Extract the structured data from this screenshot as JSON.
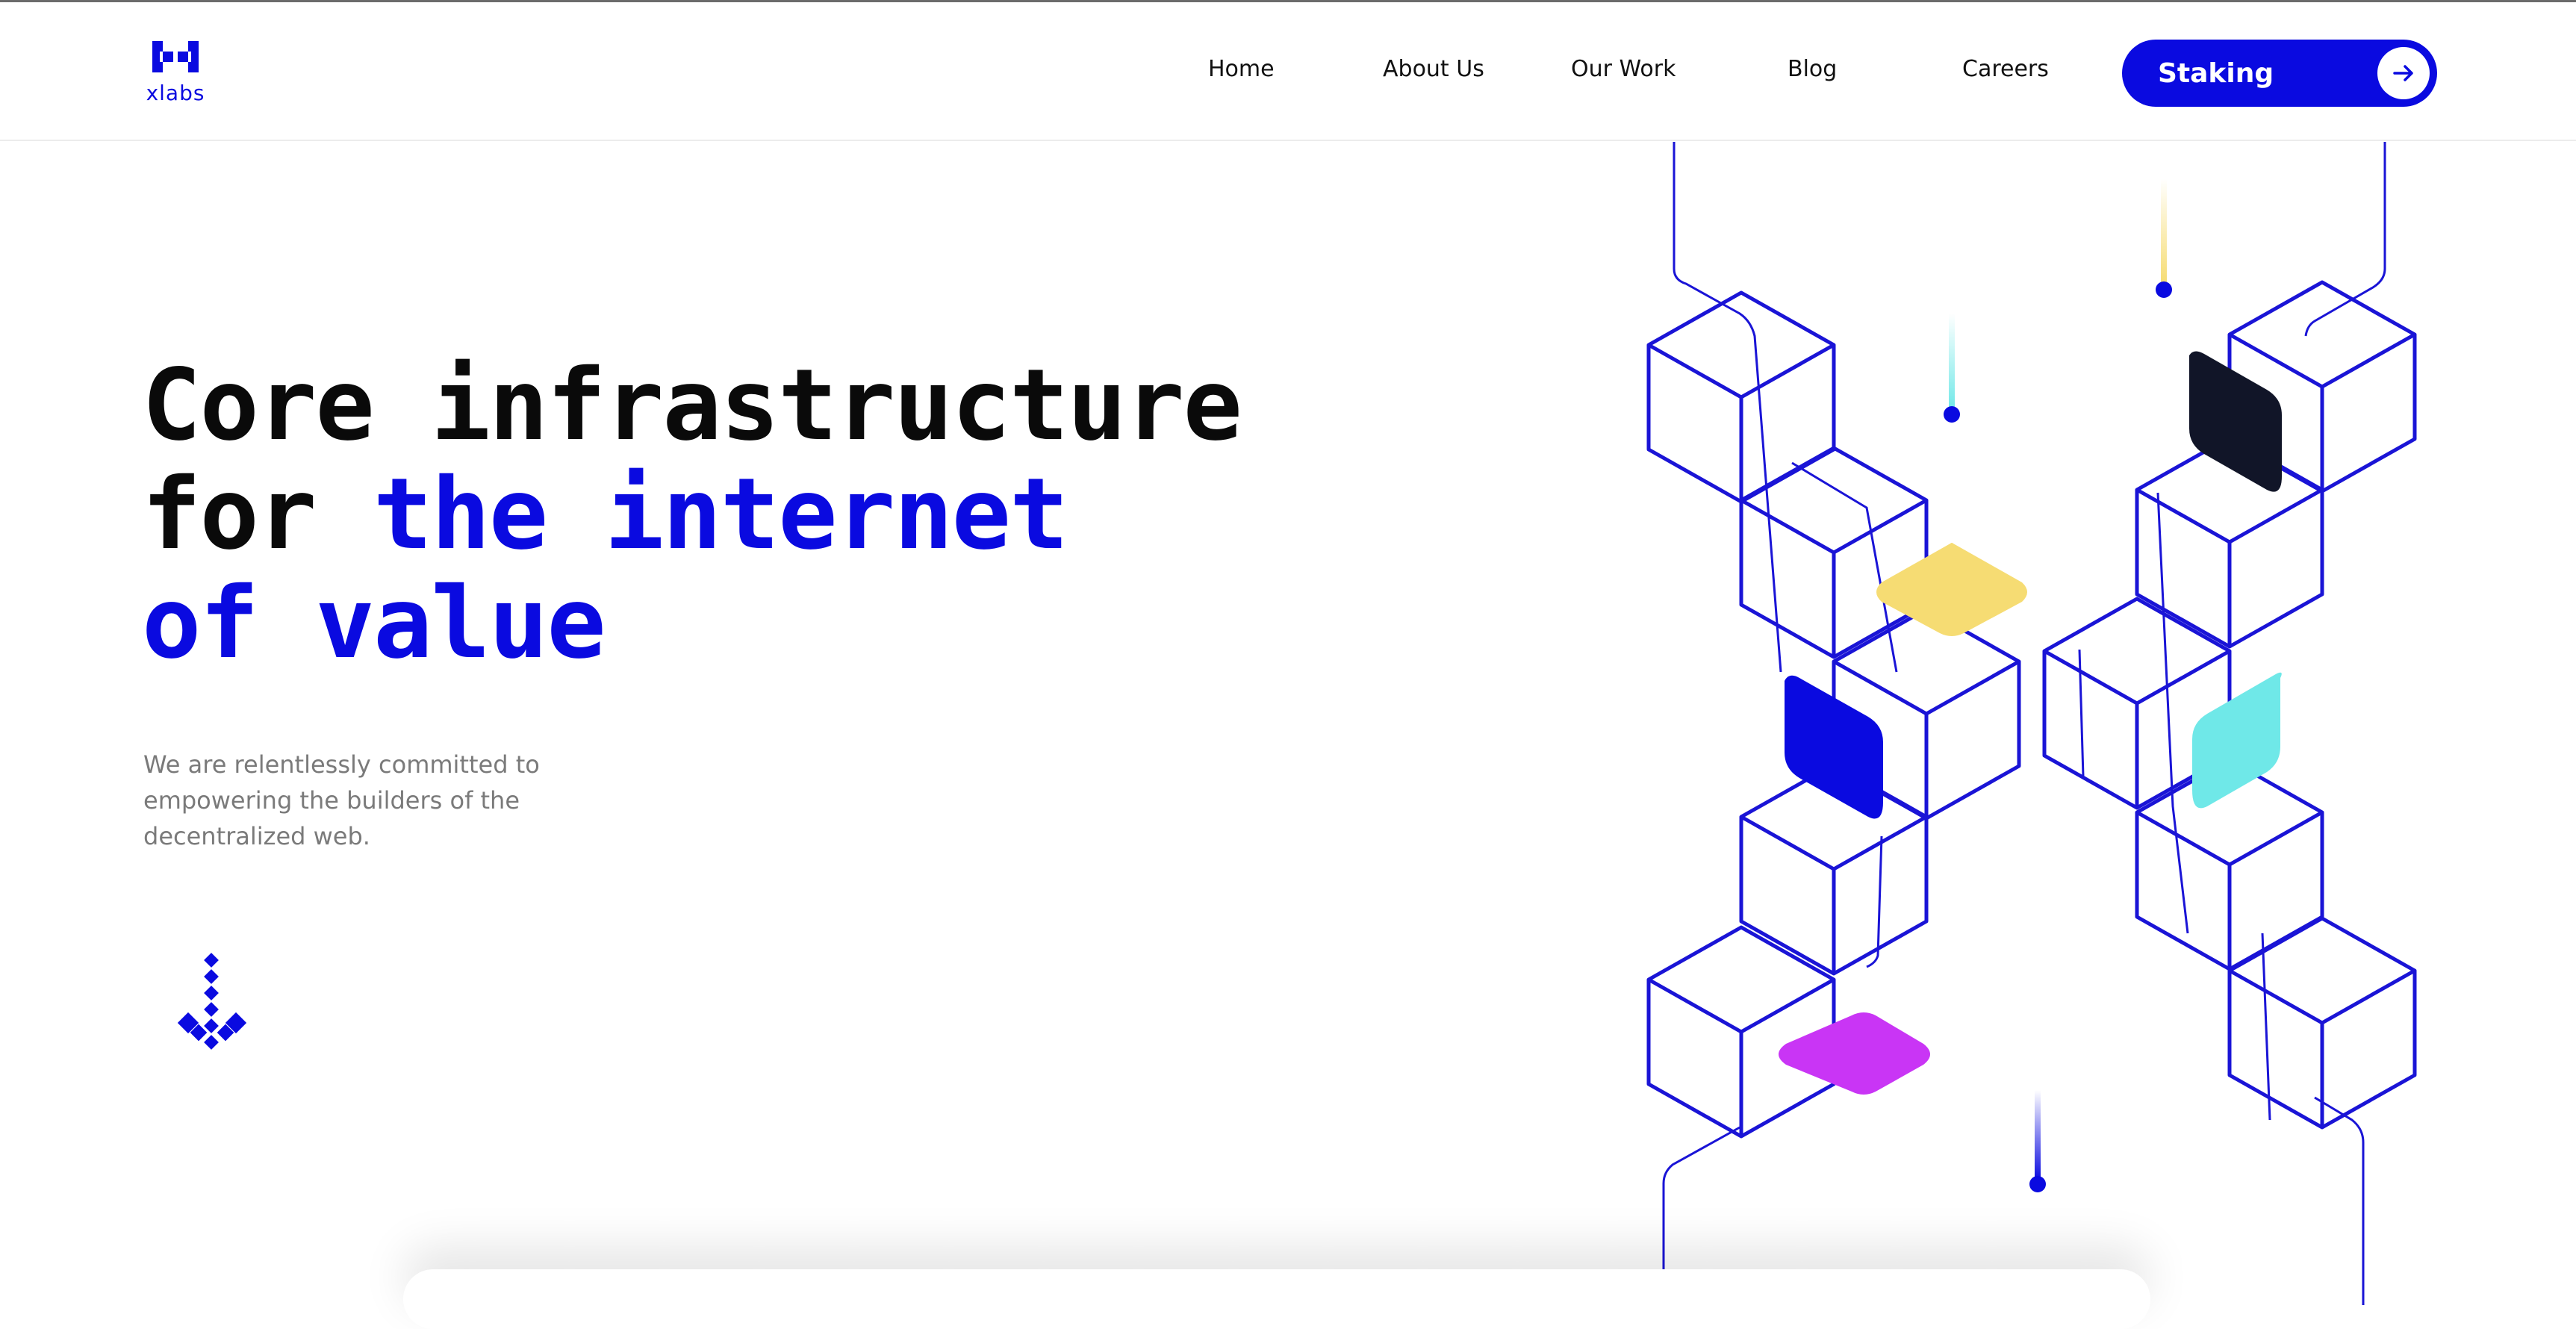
{
  "brand": {
    "logo_text": "xlabs",
    "accent": "#0a0ae0"
  },
  "nav": {
    "items": [
      {
        "label": "Home"
      },
      {
        "label": "About Us"
      },
      {
        "label": "Our Work"
      },
      {
        "label": "Blog"
      },
      {
        "label": "Careers"
      }
    ],
    "cta": {
      "label": "Staking",
      "icon": "arrow-right-icon"
    }
  },
  "hero": {
    "title_line1": "Core infrastructure",
    "title_line2_black": "for ",
    "title_line2_blue": "the internet",
    "title_line3_blue": "of value",
    "subtitle": "We are relentlessly committed to empowering the builders of the decentralized web.",
    "scroll_icon": "scroll-down-icon"
  },
  "artwork": {
    "colors": {
      "outline": "#1a14d6",
      "yellow": "#f6dc73",
      "cyan": "#6fe8e8",
      "navy": "#111528",
      "blue": "#0a0ae0",
      "magenta": "#c935f5"
    }
  }
}
